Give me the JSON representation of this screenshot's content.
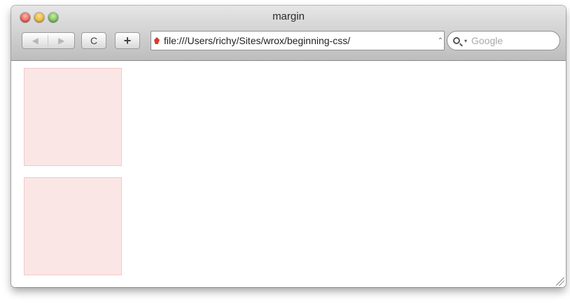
{
  "window": {
    "title": "margin"
  },
  "toolbar": {
    "back_icon": "◀",
    "forward_icon": "▶",
    "reload_icon": "C",
    "add_icon": "+"
  },
  "address": {
    "url": "file:///Users/richy/Sites/wrox/beginning-css/"
  },
  "search": {
    "placeholder": "Google",
    "dropdown_icon": "▾"
  },
  "content": {
    "boxes": [
      {
        "name": "box-1",
        "fill": "#fbe6e6"
      },
      {
        "name": "box-2",
        "fill": "#fbe6e6"
      }
    ]
  }
}
